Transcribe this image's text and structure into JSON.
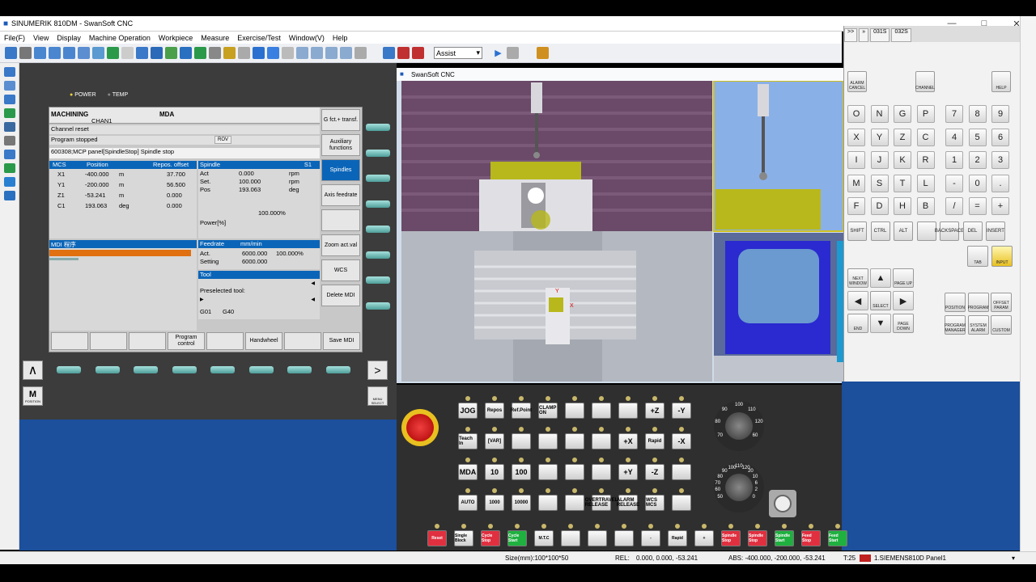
{
  "window": {
    "title": "SINUMERIK 810DM - SwanSoft CNC"
  },
  "menu": [
    "File(F)",
    "View",
    "Display",
    "Machine Operation",
    "Workpiece",
    "Measure",
    "Exercise/Test",
    "Window(V)",
    "Help"
  ],
  "toolbar": {
    "mode_value": "Assist"
  },
  "cnc": {
    "status_labels": [
      "POWER",
      "TEMP"
    ],
    "header": {
      "area": "MACHINING",
      "channel": "CHAN1",
      "mode": "MDA",
      "channel_state": "Channel reset",
      "program_state": "Program stopped",
      "rov": "ROV"
    },
    "alarm": "600308;MCP panel[SpindleStop] Spindle stop",
    "axes_header": [
      "MCS",
      "Position",
      "Repos. offset"
    ],
    "axes": [
      {
        "name": "X1",
        "pos": "-400.000",
        "unit": "m",
        "offset": "37.700"
      },
      {
        "name": "Y1",
        "pos": "-200.000",
        "unit": "m",
        "offset": "56.500"
      },
      {
        "name": "Z1",
        "pos": "-53.241",
        "unit": "m",
        "offset": "0.000"
      },
      {
        "name": "C1",
        "pos": "193.063",
        "unit": "deg",
        "offset": "0.000"
      }
    ],
    "spindle": {
      "title": "Spindle",
      "id": "S1",
      "rows": [
        {
          "label": "Act",
          "val": "0.000",
          "unit": "rpm"
        },
        {
          "label": "Set.",
          "val": "100.000",
          "unit": "rpm"
        },
        {
          "label": "Pos",
          "val": "193.063",
          "unit": "deg"
        }
      ],
      "percent": "100.000%",
      "power": "Power[%]"
    },
    "mdi": {
      "title": "MDI 程序"
    },
    "feedrate": {
      "title": "Feedrate",
      "unit": "mm/min",
      "act_label": "Act.",
      "act": "6000.000",
      "pct": "100.000%",
      "setting_label": "Setting",
      "setting": "6000.000"
    },
    "tool": {
      "title": "Tool",
      "preselected": "Preselected tool:",
      "g1": "G01",
      "g2": "G40"
    },
    "right_softkeys": [
      "G fct.+ transf.",
      "Auxiliary functions",
      "Spindles",
      "Axis feedrate",
      "",
      "Zoom act.val",
      "WCS",
      "Delete MDI"
    ],
    "bottom_softkeys": [
      "",
      "",
      "",
      "Program control",
      "",
      "Handwheel",
      "",
      "Save MDI"
    ],
    "bottom_left_key": "M",
    "bottom_left_label": "POSITION",
    "menu_select": "MENU SELECT"
  },
  "viewport": {
    "title": "SwanSoft CNC"
  },
  "keypanel": {
    "top_tabs": [
      ">>",
      "»",
      "031S",
      "032S"
    ],
    "top_keys": [
      {
        "label": "ALARM CANCEL"
      },
      {
        "label": "CHANNEL",
        "glyph": "1..n"
      },
      {
        "label": "HELP"
      }
    ],
    "letters": [
      [
        "O",
        "N",
        "G",
        "P"
      ],
      [
        "X",
        "Y",
        "Z",
        "C"
      ],
      [
        "I",
        "J",
        "K",
        "R"
      ],
      [
        "M",
        "S",
        "T",
        "L"
      ],
      [
        "F",
        "D",
        "H",
        "B"
      ]
    ],
    "digits": [
      [
        "7",
        "8",
        "9"
      ],
      [
        "4",
        "5",
        "6"
      ],
      [
        "1",
        "2",
        "3"
      ],
      [
        "-",
        "0",
        "."
      ],
      [
        "/",
        "=",
        "+"
      ]
    ],
    "mods": [
      "SHIFT",
      "CTRL",
      "ALT",
      "",
      "BACKSPACE",
      "DEL",
      "INSERT"
    ],
    "tab_input": [
      "TAB",
      "INPUT"
    ],
    "nav": [
      "NEXT WINDOW",
      "PAGE UP",
      "SELECT",
      "END",
      "PAGE DOWN"
    ],
    "func": [
      "POSITION",
      "PROGRAM",
      "OFFSET PARAM",
      "PROGRAM MANAGER",
      "SYSTEM ALARM",
      "CUSTOM"
    ]
  },
  "mcp": {
    "rows": [
      [
        "JOG",
        "Repos",
        "Ref.Point",
        "CLAMP ON",
        "",
        "",
        "",
        "+Z",
        "-Y"
      ],
      [
        "Teach In",
        "[VAR]",
        "",
        "",
        "",
        "",
        "+X",
        "Rapid",
        "-X"
      ],
      [
        "MDA",
        "10",
        "100",
        "",
        "",
        "",
        "+Y",
        "-Z",
        ""
      ],
      [
        "AUTO",
        "1000",
        "10000",
        "",
        "",
        "OVERTRAVEL RELEASE",
        "ALARM RELEASE",
        "WCS MCS",
        ""
      ]
    ],
    "bottom": [
      "Reset",
      "Single Block",
      "Cycle Stop",
      "Cycle Start",
      "M.T.C",
      "",
      "",
      "",
      "-",
      "Rapid",
      "+",
      "Spindle Stop",
      "Spindle Stop",
      "Spindle Start",
      "Feed Stop",
      "Feed Start"
    ],
    "feed_override": [
      "70",
      "80",
      "90",
      "100",
      "110",
      "120",
      "60"
    ],
    "spindle_override": [
      "50",
      "60",
      "70",
      "80",
      "90",
      "100",
      "110",
      "120",
      "20",
      "10",
      "6",
      "2",
      "0"
    ]
  },
  "statusbar": {
    "size": "Size(mm):100*100*50",
    "rel": "REL:",
    "rel_vals": "0.000,   0.000,  -53.241",
    "abs": "ABS: -400.000, -200.000, -53.241",
    "tool": "T:25",
    "panel": "1.SIEMENS810D Panel1"
  },
  "colors": {
    "screen_blue": "#0a65b8",
    "mdi_orange": "#e07010",
    "panel_blue": "#1c4f9c"
  }
}
